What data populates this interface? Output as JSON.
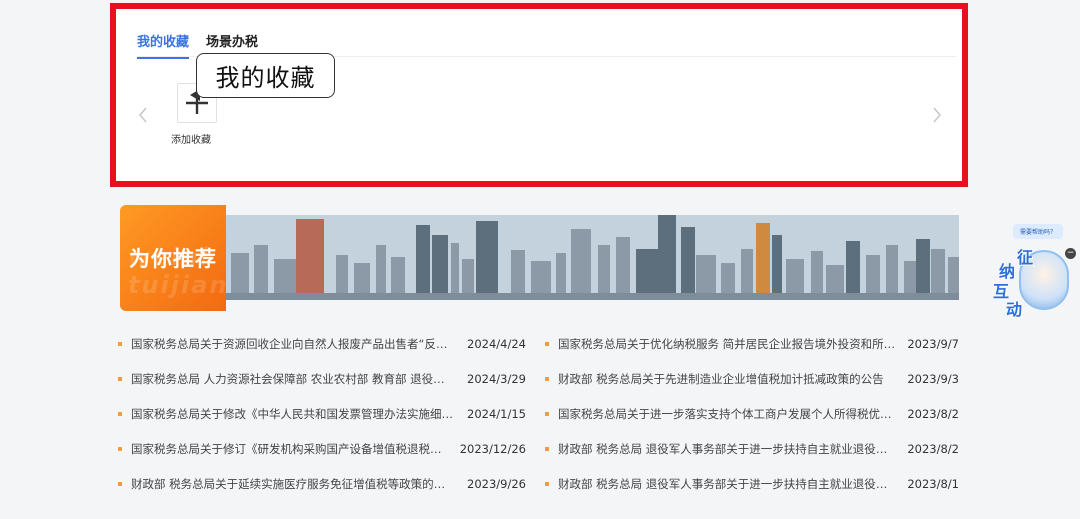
{
  "favorites": {
    "tabs": [
      "我的收藏",
      "场景办税"
    ],
    "add_label": "添加收藏",
    "tooltip": "我的收藏"
  },
  "banner": {
    "title": "为你推荐",
    "watermark": "weini tuijian"
  },
  "news_left": [
    {
      "title": "国家税务总局关于资源回收企业向自然人报废产品出售者“反向开票”有关事项的公告",
      "date": "2024/4/24"
    },
    {
      "title": "国家税务总局 人力资源社会保障部 农业农村部 教育部 退役军人事务部关于重点群体和自主就业退役士兵创业就业税收政策有关执行问题的公告",
      "date": "2024/3/29"
    },
    {
      "title": "国家税务总局关于修改《中华人民共和国发票管理办法实施细则》的决定",
      "date": "2024/1/15"
    },
    {
      "title": "国家税务总局关于修订《研发机构采购国产设备增值税退税管理办法》的公告",
      "date": "2023/12/26"
    },
    {
      "title": "财政部 税务总局关于延续实施医疗服务免征增值税等政策的公告",
      "date": "2023/9/26"
    }
  ],
  "news_right": [
    {
      "title": "国家税务总局关于优化纳税服务 简并居民企业报告境外投资和所得信息有关报表的公告",
      "date": "2023/9/7"
    },
    {
      "title": "财政部 税务总局关于先进制造业企业增值税加计抵减政策的公告",
      "date": "2023/9/3"
    },
    {
      "title": "国家税务总局关于进一步落实支持个体工商户发展个人所得税优惠政策有关事项的公告",
      "date": "2023/8/2"
    },
    {
      "title": "财政部 税务总局 退役军人事务部关于进一步扶持自主就业退役士兵创业就业有关税收政策的公告",
      "date": "2023/8/2"
    },
    {
      "title": "财政部 税务总局 退役军人事务部关于进一步扶持自主就业退役士兵创业就业有关税收政策的公告",
      "date": "2023/8/1"
    }
  ],
  "helper": {
    "bubble": "需要帮助吗？",
    "chars": [
      "征",
      "纳",
      "互",
      "动"
    ],
    "close": "−"
  },
  "colors": {
    "highlight_border": "#e8101c",
    "tab_active": "#3b73e0",
    "banner_orange": "#f36a10",
    "news_bullet": "#f39d3a"
  },
  "icons": {
    "prev": "chevron-left-icon",
    "next": "chevron-right-icon",
    "add": "plus-icon"
  }
}
